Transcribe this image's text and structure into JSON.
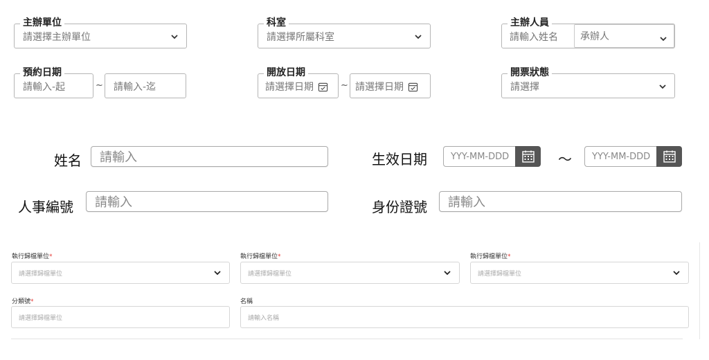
{
  "top_form": {
    "host_unit": {
      "legend": "主辦單位",
      "placeholder": "請選擇主辦單位"
    },
    "department": {
      "legend": "科室",
      "placeholder": "請選擇所屬科室"
    },
    "host_person": {
      "legend": "主辦人員",
      "name_placeholder": "請輸入姓名",
      "role_value": "承辦人"
    },
    "reserve_date": {
      "legend": "預約日期",
      "from_placeholder": "請輸入-起",
      "separator": "~",
      "to_placeholder": "請輸入-迄"
    },
    "open_date": {
      "legend": "開放日期",
      "from_placeholder": "請選擇日期",
      "separator": "~",
      "to_placeholder": "請選擇日期"
    },
    "ticket_status": {
      "legend": "開票狀態",
      "placeholder": "請選擇"
    }
  },
  "mid_form": {
    "name": {
      "label": "姓名",
      "placeholder": "請輸入"
    },
    "effective_date": {
      "label": "生效日期",
      "from_placeholder": "YYY-MM-DDD",
      "separator": "～",
      "to_placeholder": "YYY-MM-DDD"
    },
    "employee_no": {
      "label": "人事編號",
      "placeholder": "請輸入"
    },
    "id_no": {
      "label": "身份證號",
      "placeholder": "請輸入"
    }
  },
  "bottom_form": {
    "archive_unit_1": {
      "label": "執行歸檔單位",
      "required_mark": "*",
      "placeholder": "請選擇歸檔單位"
    },
    "archive_unit_2": {
      "label": "執行歸檔單位",
      "required_mark": "*",
      "placeholder": "請選擇歸檔單位"
    },
    "archive_unit_3": {
      "label": "執行歸檔單位",
      "required_mark": "*",
      "placeholder": "請選擇歸檔單位"
    },
    "category_no": {
      "label": "分類號",
      "required_mark": "*",
      "placeholder": "請選擇歸檔單位"
    },
    "name": {
      "label": "名稱",
      "placeholder": "請輸入名稱"
    }
  },
  "colors": {
    "calendar_button": "#555555",
    "required": "#e53935",
    "border": "#b5b5b5"
  },
  "icons": {
    "dropdown": "chevron-down-icon",
    "calendar": "calendar-icon"
  }
}
